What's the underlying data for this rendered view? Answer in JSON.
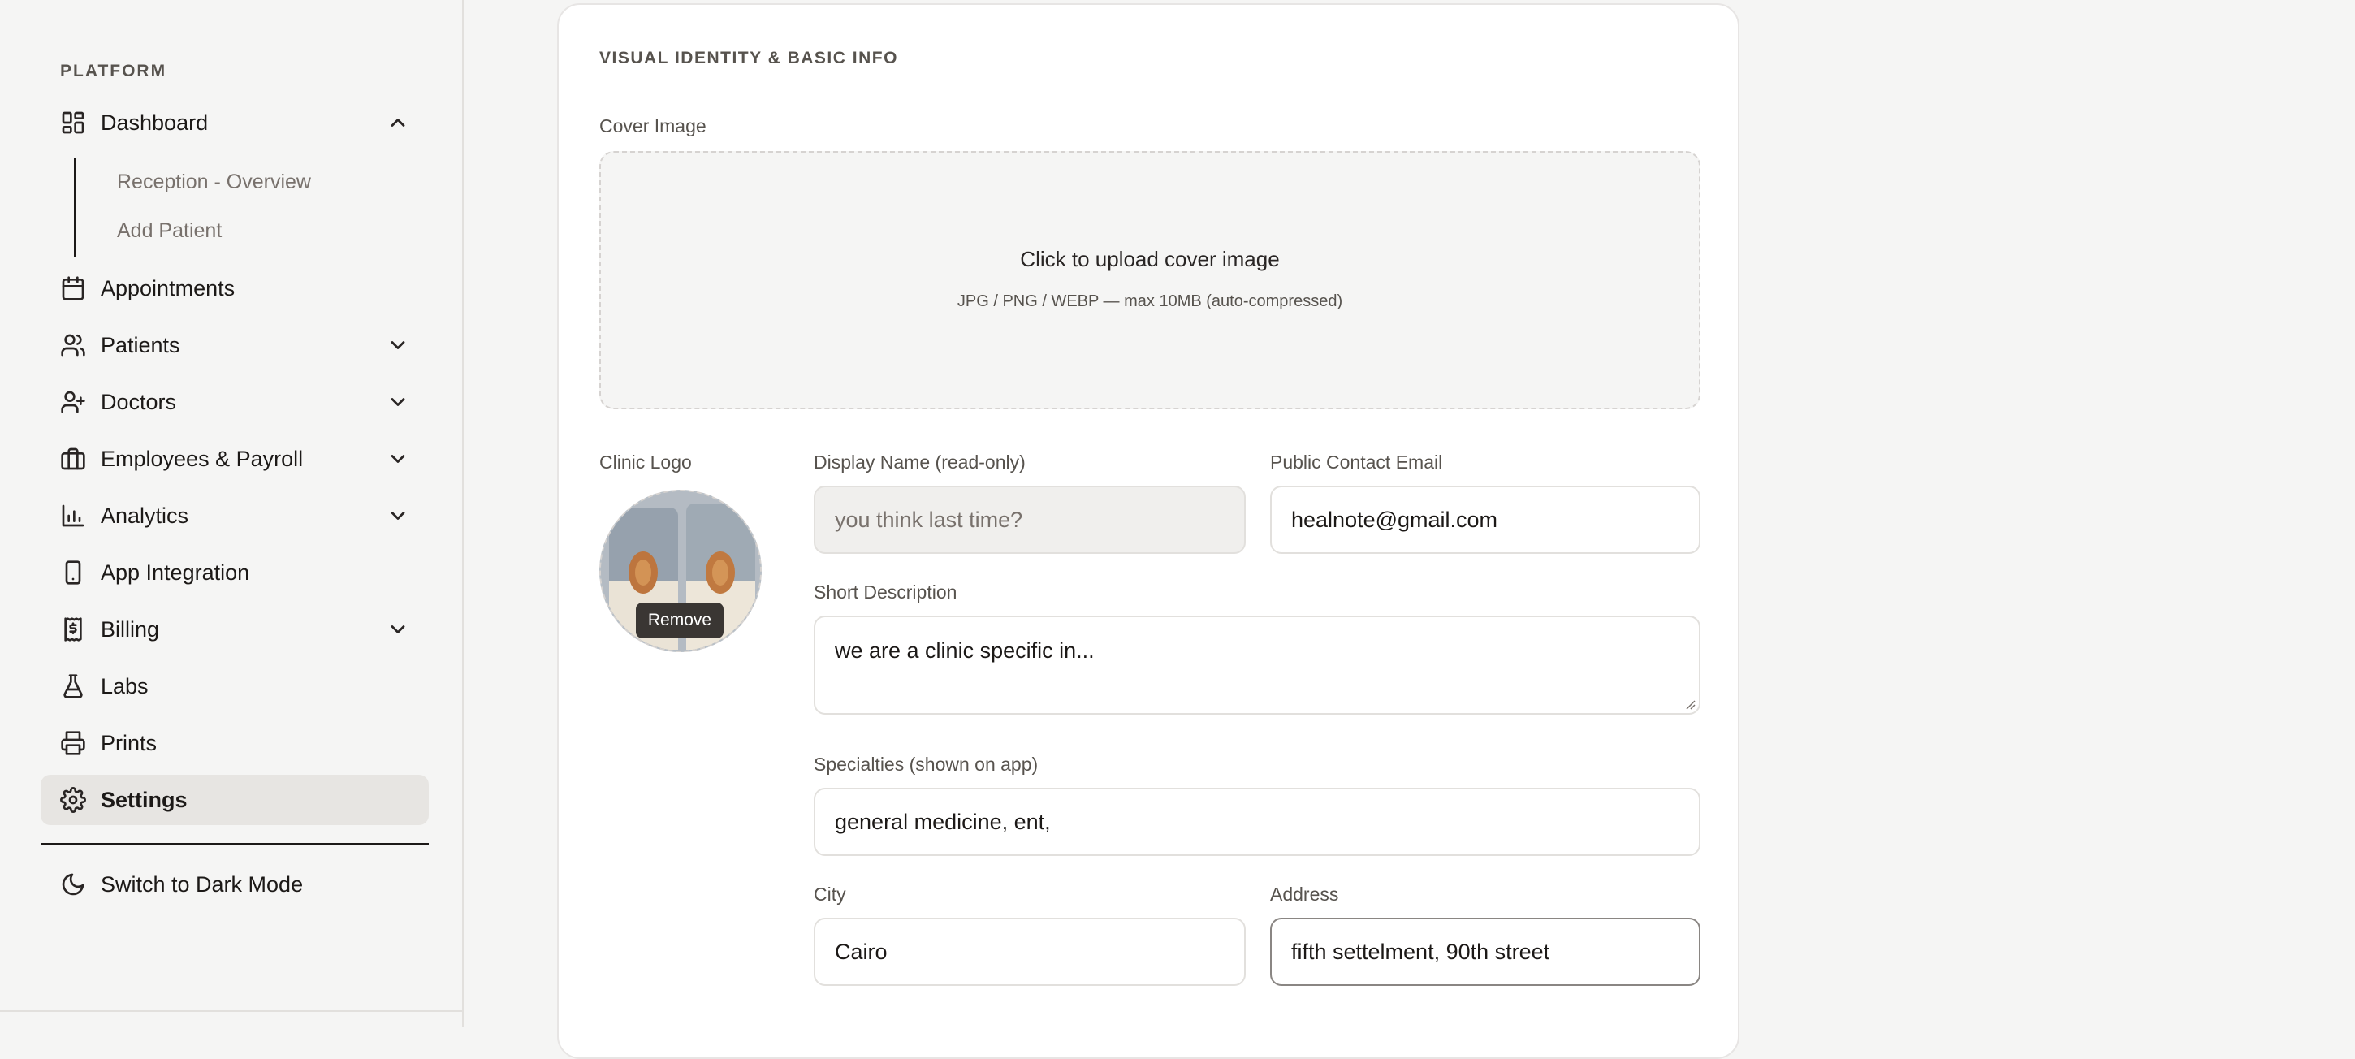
{
  "sidebar": {
    "section_label": "PLATFORM",
    "items": [
      {
        "label": "Dashboard",
        "icon": "dashboard-icon",
        "chevron": "up"
      },
      {
        "label": "Appointments",
        "icon": "calendar-icon"
      },
      {
        "label": "Patients",
        "icon": "users-icon",
        "chevron": "down"
      },
      {
        "label": "Doctors",
        "icon": "user-plus-icon",
        "chevron": "down"
      },
      {
        "label": "Employees & Payroll",
        "icon": "briefcase-icon",
        "chevron": "down"
      },
      {
        "label": "Analytics",
        "icon": "bar-chart-icon",
        "chevron": "down"
      },
      {
        "label": "App Integration",
        "icon": "smartphone-icon"
      },
      {
        "label": "Billing",
        "icon": "receipt-icon",
        "chevron": "down"
      },
      {
        "label": "Labs",
        "icon": "flask-icon"
      },
      {
        "label": "Prints",
        "icon": "printer-icon"
      },
      {
        "label": "Settings",
        "icon": "gear-icon",
        "active": true
      }
    ],
    "dashboard_subitems": [
      "Reception - Overview",
      "Add Patient"
    ],
    "theme_toggle": "Switch to Dark Mode"
  },
  "card": {
    "title": "VISUAL IDENTITY & BASIC INFO",
    "cover_label": "Cover Image",
    "upload_title": "Click to upload cover image",
    "upload_hint": "JPG / PNG / WEBP — max 10MB (auto-compressed)",
    "logo_label": "Clinic Logo",
    "remove_label": "Remove",
    "display_name_label": "Display Name (read-only)",
    "display_name_value": "you think last time?",
    "email_label": "Public Contact Email",
    "email_value": "healnote@gmail.com",
    "short_desc_label": "Short Description",
    "short_desc_value": "we are a clinic specific in...",
    "specialties_label": "Specialties (shown on app)",
    "specialties_value": "general medicine, ent,",
    "city_label": "City",
    "city_value": "Cairo",
    "address_label": "Address",
    "address_value": "fifth settelment, 90th street"
  },
  "colors": {
    "background": "#f5f5f4",
    "active_item": "#e7e5e2",
    "card": "#ffffff",
    "border": "#e2e0dd"
  }
}
